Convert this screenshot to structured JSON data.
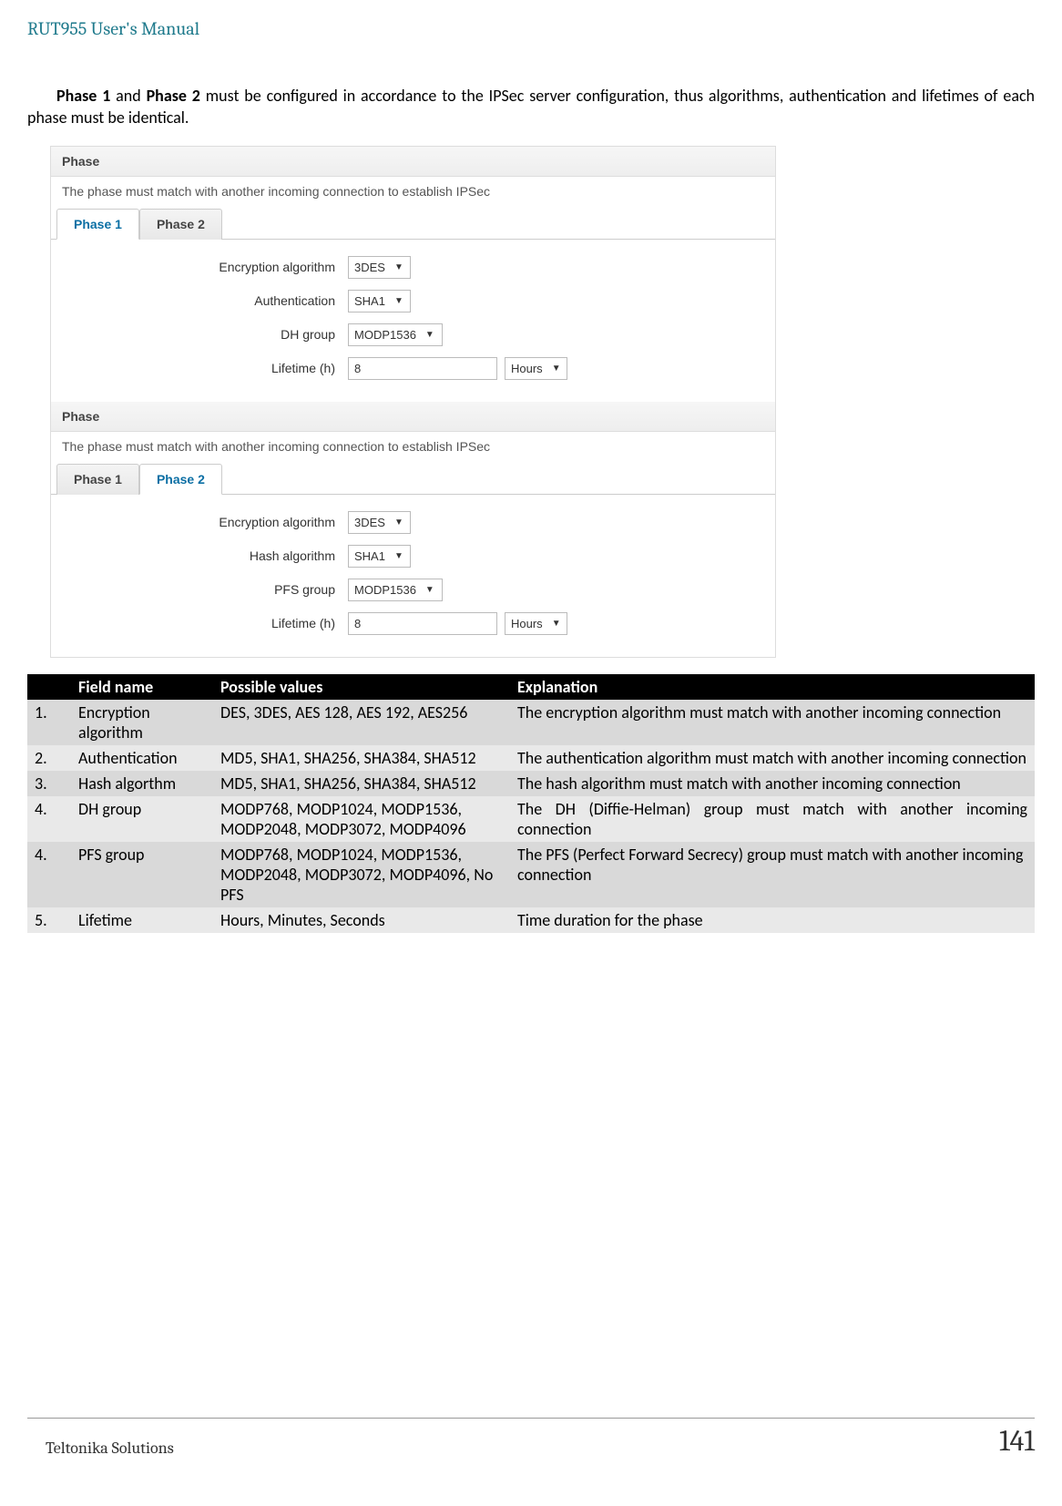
{
  "header": {
    "title": "RUT955 User's Manual"
  },
  "intro": {
    "phase1": "Phase 1",
    "and": " and ",
    "phase2": "Phase 2",
    "rest": " must be configured in accordance to the IPSec server configuration, thus algorithms, authentication and lifetimes of each phase must be identical."
  },
  "ui": {
    "section_title": "Phase",
    "desc_text": "The phase must match with another incoming connection to establish IPSec",
    "tab_phase1": "Phase 1",
    "tab_phase2": "Phase 2",
    "p1": {
      "enc_label": "Encryption algorithm",
      "enc_value": "3DES",
      "auth_label": "Authentication",
      "auth_value": "SHA1",
      "dh_label": "DH group",
      "dh_value": "MODP1536",
      "life_label": "Lifetime (h)",
      "life_value": "8",
      "life_unit": "Hours"
    },
    "p2": {
      "enc_label": "Encryption algorithm",
      "enc_value": "3DES",
      "hash_label": "Hash algorithm",
      "hash_value": "SHA1",
      "pfs_label": "PFS group",
      "pfs_value": "MODP1536",
      "life_label": "Lifetime (h)",
      "life_value": "8",
      "life_unit": "Hours"
    }
  },
  "table": {
    "headers": {
      "field": "Field name",
      "possible": "Possible values",
      "explain": "Explanation"
    },
    "rows": [
      {
        "n": "1.",
        "field": "Encryption algorithm",
        "possible": "DES, 3DES, AES 128, AES 192, AES256",
        "explain": "The encryption algorithm must match with another incoming connection"
      },
      {
        "n": "2.",
        "field": "Authentication",
        "possible": "MD5, SHA1, SHA256, SHA384, SHA512",
        "explain": "The authentication algorithm must match with another incoming connection"
      },
      {
        "n": "3.",
        "field": "Hash algorthm",
        "possible": "MD5, SHA1, SHA256, SHA384, SHA512",
        "explain": "The hash algorithm must match with another incoming connection"
      },
      {
        "n": "4.",
        "field": "DH group",
        "possible": "MODP768,  MODP1024, MODP1536, MODP2048, MODP3072, MODP4096",
        "explain": "The DH (Diffie-Helman) group must match with another incoming connection"
      },
      {
        "n": "4.",
        "field": "PFS group",
        "possible": "MODP768,  MODP1024, MODP1536, MODP2048, MODP3072, MODP4096, No PFS",
        "explain": "The PFS (Perfect Forward Secrecy) group must match with another incoming connection"
      },
      {
        "n": "5.",
        "field": "Lifetime",
        "possible": "Hours, Minutes, Seconds",
        "explain": "Time duration for the phase"
      }
    ]
  },
  "footer": {
    "company": "Teltonika Solutions",
    "page": "141"
  }
}
